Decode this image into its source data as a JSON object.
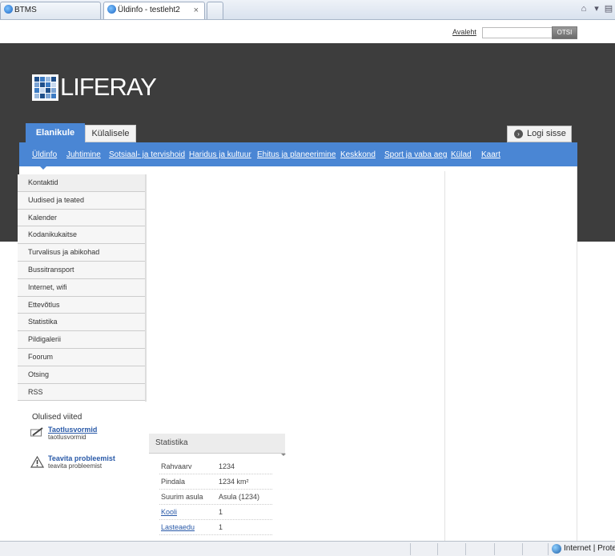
{
  "browser": {
    "tabs": [
      {
        "title": "BTMS"
      },
      {
        "title": "Üldinfo - testleht2"
      }
    ],
    "tab_close_glyph": "×"
  },
  "top": {
    "home_link": "Avaleht",
    "search_placeholder": "",
    "search_button": "OTSI"
  },
  "logo": {
    "text": "LIFERAY",
    "mark_colors": [
      "#1f4f8a",
      "#3d7cc4",
      "#9bbbe0",
      "#1f4f8a",
      "#7aa3d4",
      "#1f4f8a",
      "#3d7cc4",
      "#c9daef",
      "#3d7cc4",
      "#c9daef",
      "#1f4f8a",
      "#7aa3d4",
      "#9bbbe0",
      "#1f4f8a",
      "#7aa3d4",
      "#3d7cc4"
    ]
  },
  "site_tabs": {
    "elanikule": "Elanikule",
    "kulalisele": "Külalisele",
    "login": "Logi sisse"
  },
  "nav": [
    "Üldinfo",
    "Juhtimine",
    "Sotsiaal- ja tervishoid",
    "Haridus ja kultuur",
    "Ehitus ja planeerimine",
    "Keskkond",
    "Sport ja vaba aeg",
    "Külad",
    "Kaart"
  ],
  "side_menu": [
    "Kontaktid",
    "Uudised ja teated",
    "Kalender",
    "Kodanikukaitse",
    "Turvalisus ja abikohad",
    "Bussitransport",
    "Internet, wifi",
    "Ettevõtlus",
    "Statistika",
    "Pildigalerii",
    "Foorum",
    "Otsing",
    "RSS"
  ],
  "important_links": {
    "title": "Olulised viited",
    "items": [
      {
        "label": "Taotlusvormid",
        "subtitle": "taotlusvormid",
        "icon": "pencil-icon"
      },
      {
        "label": "Teavita probleemist",
        "subtitle": "teavita probleemist",
        "icon": "warning-icon"
      }
    ]
  },
  "statistics": {
    "title": "Statistika",
    "rows": [
      {
        "key": "Rahvaarv",
        "value": "1234",
        "link": false
      },
      {
        "key": "Pindala",
        "value": "1234 km²",
        "link": false
      },
      {
        "key": "Suurim asula",
        "value": "Asula (1234)",
        "link": false
      },
      {
        "key": "Kooli",
        "value": "1",
        "link": true
      },
      {
        "key": "Lasteaedu",
        "value": "1",
        "link": true
      }
    ]
  },
  "statusbar": {
    "zone": "Internet | Protected"
  },
  "colors": {
    "accent": "#4a86d4",
    "header_bg": "#3d3d3d",
    "link": "#2a5aa8"
  }
}
